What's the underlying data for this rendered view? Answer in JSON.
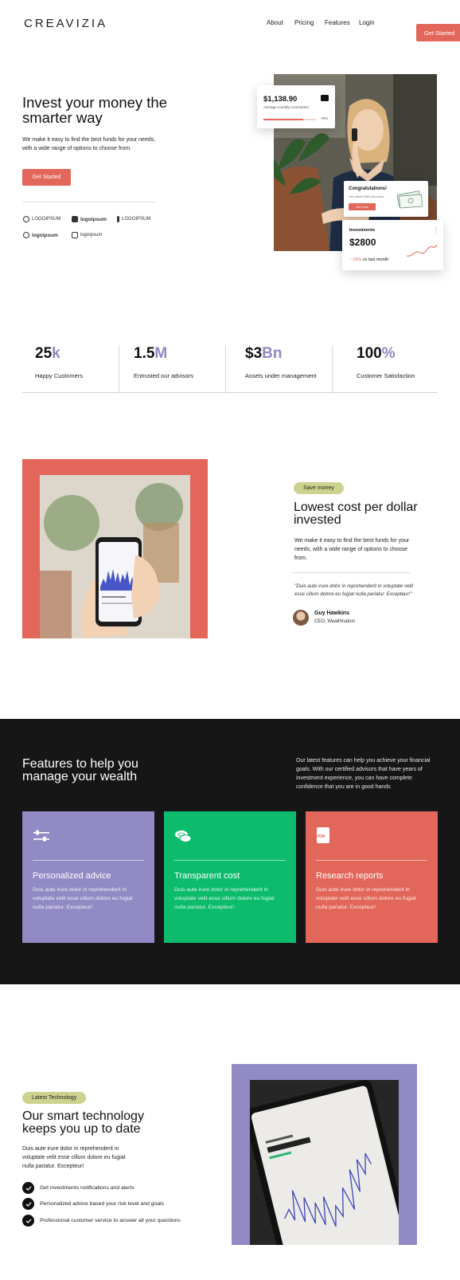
{
  "nav": {
    "logo": "CREAVIZIA",
    "links": [
      "About",
      "Pricing",
      "Features",
      "Login"
    ],
    "cta": "Get Started"
  },
  "hero": {
    "title": "Invest your money the smarter way",
    "subtitle": "We make it easy to find the best funds for your needs, with a wide range of options to choose from.",
    "cta": "Get Started",
    "partners": [
      "LOGOIPSUM",
      "logoipsum",
      "LOGOIPSUM",
      "logoipsum",
      "logoipsum"
    ],
    "investment_card": {
      "amount": "$1,138.90",
      "label": "Average monthly investment",
      "progress": "76%",
      "progress_value": 0.76
    },
    "congrats_card": {
      "title": "Congratulations!",
      "subtitle": "You saved $60 this week",
      "button": "Get it now"
    },
    "investments_card": {
      "title": "Investments",
      "amount": "$2800",
      "change_value": "15%",
      "change_label": "vs last month"
    }
  },
  "stats": [
    {
      "num": "25",
      "suffix": "k",
      "label": "Happy Customers"
    },
    {
      "num": "1.5",
      "suffix": "M",
      "label": "Entrusted our advisors"
    },
    {
      "num": "$3",
      "suffix": "Bn",
      "label": "Assets under management"
    },
    {
      "num": "100",
      "suffix": "%",
      "label": "Customer Satisfaction"
    }
  ],
  "save": {
    "badge": "Save money",
    "title": "Lowest cost per dollar invested",
    "subtitle": "We make it easy to find the best funds for your needs, with a wide range of options to choose from.",
    "quote": "\"Duis aute irure dolor in reprehenderit in voluptate velit esse cillum dolore eu fugiat nulla pariatur. Excepteur!\"",
    "author": "Guy Hawkins",
    "role": "CEO, Wealthnation"
  },
  "features": {
    "title": "Features to help you manage your wealth",
    "subtitle": "Our latest features can help you achieve your financial goals. With our certified advisors that have years of investment experience, you can have complete confidence that you are in good hands",
    "cards": [
      {
        "title": "Personalized advice",
        "text": "Duis aute irure dolor in reprehenderit in voluptate velit esse cillum dolore eu fugiat nulla pariatur. Excepteur!",
        "color": "#918ac4",
        "icon": "sliders-icon"
      },
      {
        "title": "Transparent cost",
        "text": "Duis aute irure dolor in reprehenderit in voluptate velit esse cillum dolore eu fugiat nulla pariatur. Excepteur!",
        "color": "#0cbb6c",
        "icon": "coins-icon"
      },
      {
        "title": "Research reports",
        "text": "Duis aute irure dolor in reprehenderit in voluptate velit esse cillum dolore eu fugiat nulla pariatur. Excepteur!",
        "color": "#e2665a",
        "icon": "pdf-icon",
        "icon_text": "PDF"
      }
    ]
  },
  "tech": {
    "badge": "Latest Technology",
    "title": "Our smart technology keeps you up to date",
    "subtitle": "Duis aute irure dolor in reprehenderit in voluptate velit esse cillum dolore eu fugiat nulla pariatur. Excepteur!",
    "checks": [
      "Get investments notifications and alerts",
      "Personalized advice based your risk level and goals",
      "Professional customer service to answer all your questions"
    ]
  },
  "colors": {
    "coral": "#e2665a",
    "purple": "#918ac4",
    "green": "#0cbb6c",
    "dark": "#161616",
    "olive_badge": "#cdd38e"
  }
}
